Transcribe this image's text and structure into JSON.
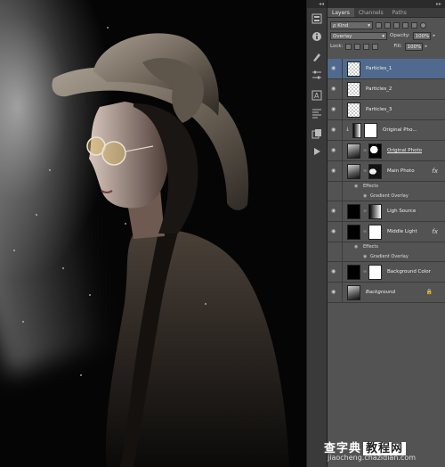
{
  "canvas": {
    "description_icons": [
      "woman-portrait-image"
    ]
  },
  "toolstrip": {
    "collapse": "◂◂",
    "tools": [
      "history-icon",
      "info-icon",
      "brush-icon",
      "adjust-icon",
      "character-icon",
      "paragraph-icon",
      "clone-icon",
      "play-icon"
    ]
  },
  "panel": {
    "collapse": "▸▸",
    "tabs": [
      "Layers",
      "Channels",
      "Paths"
    ],
    "kind_label": "ρ Kind",
    "blend_mode": "Overlay",
    "opacity_label": "Opacity:",
    "opacity_value": "100%",
    "lock_label": "Lock:",
    "fill_label": "Fill:",
    "fill_value": "100%"
  },
  "layers": [
    {
      "name": "Particles_1",
      "thumb": "trans",
      "selected": true
    },
    {
      "name": "Particles_2",
      "thumb": "trans"
    },
    {
      "name": "Particles_3",
      "thumb": "trans"
    },
    {
      "name": "Original Pho...",
      "thumb": "white",
      "adjust": true,
      "clip": true
    },
    {
      "name": "Original Photo",
      "thumb": "photo",
      "mask": "mask",
      "underline": true
    },
    {
      "name": "Main Photo",
      "thumb": "photo",
      "mask": "mask2",
      "fx": "fx",
      "effects": [
        "Effects",
        "Gradient Overlay"
      ]
    },
    {
      "name": "Ligh Source",
      "thumb": "black",
      "mask": "grad"
    },
    {
      "name": "Middle Light",
      "thumb": "black",
      "mask": "white",
      "fx": "fx",
      "effects": [
        "Effects",
        "Gradient Overlay"
      ]
    },
    {
      "name": "Background Color",
      "thumb": "black",
      "mask": "white"
    },
    {
      "name": "Background",
      "thumb": "photo",
      "italic": true,
      "lock": "🔒"
    }
  ],
  "watermark": {
    "title_a": "查字典",
    "title_b": "教程网",
    "url": "jiaocheng.chazidian.com"
  }
}
